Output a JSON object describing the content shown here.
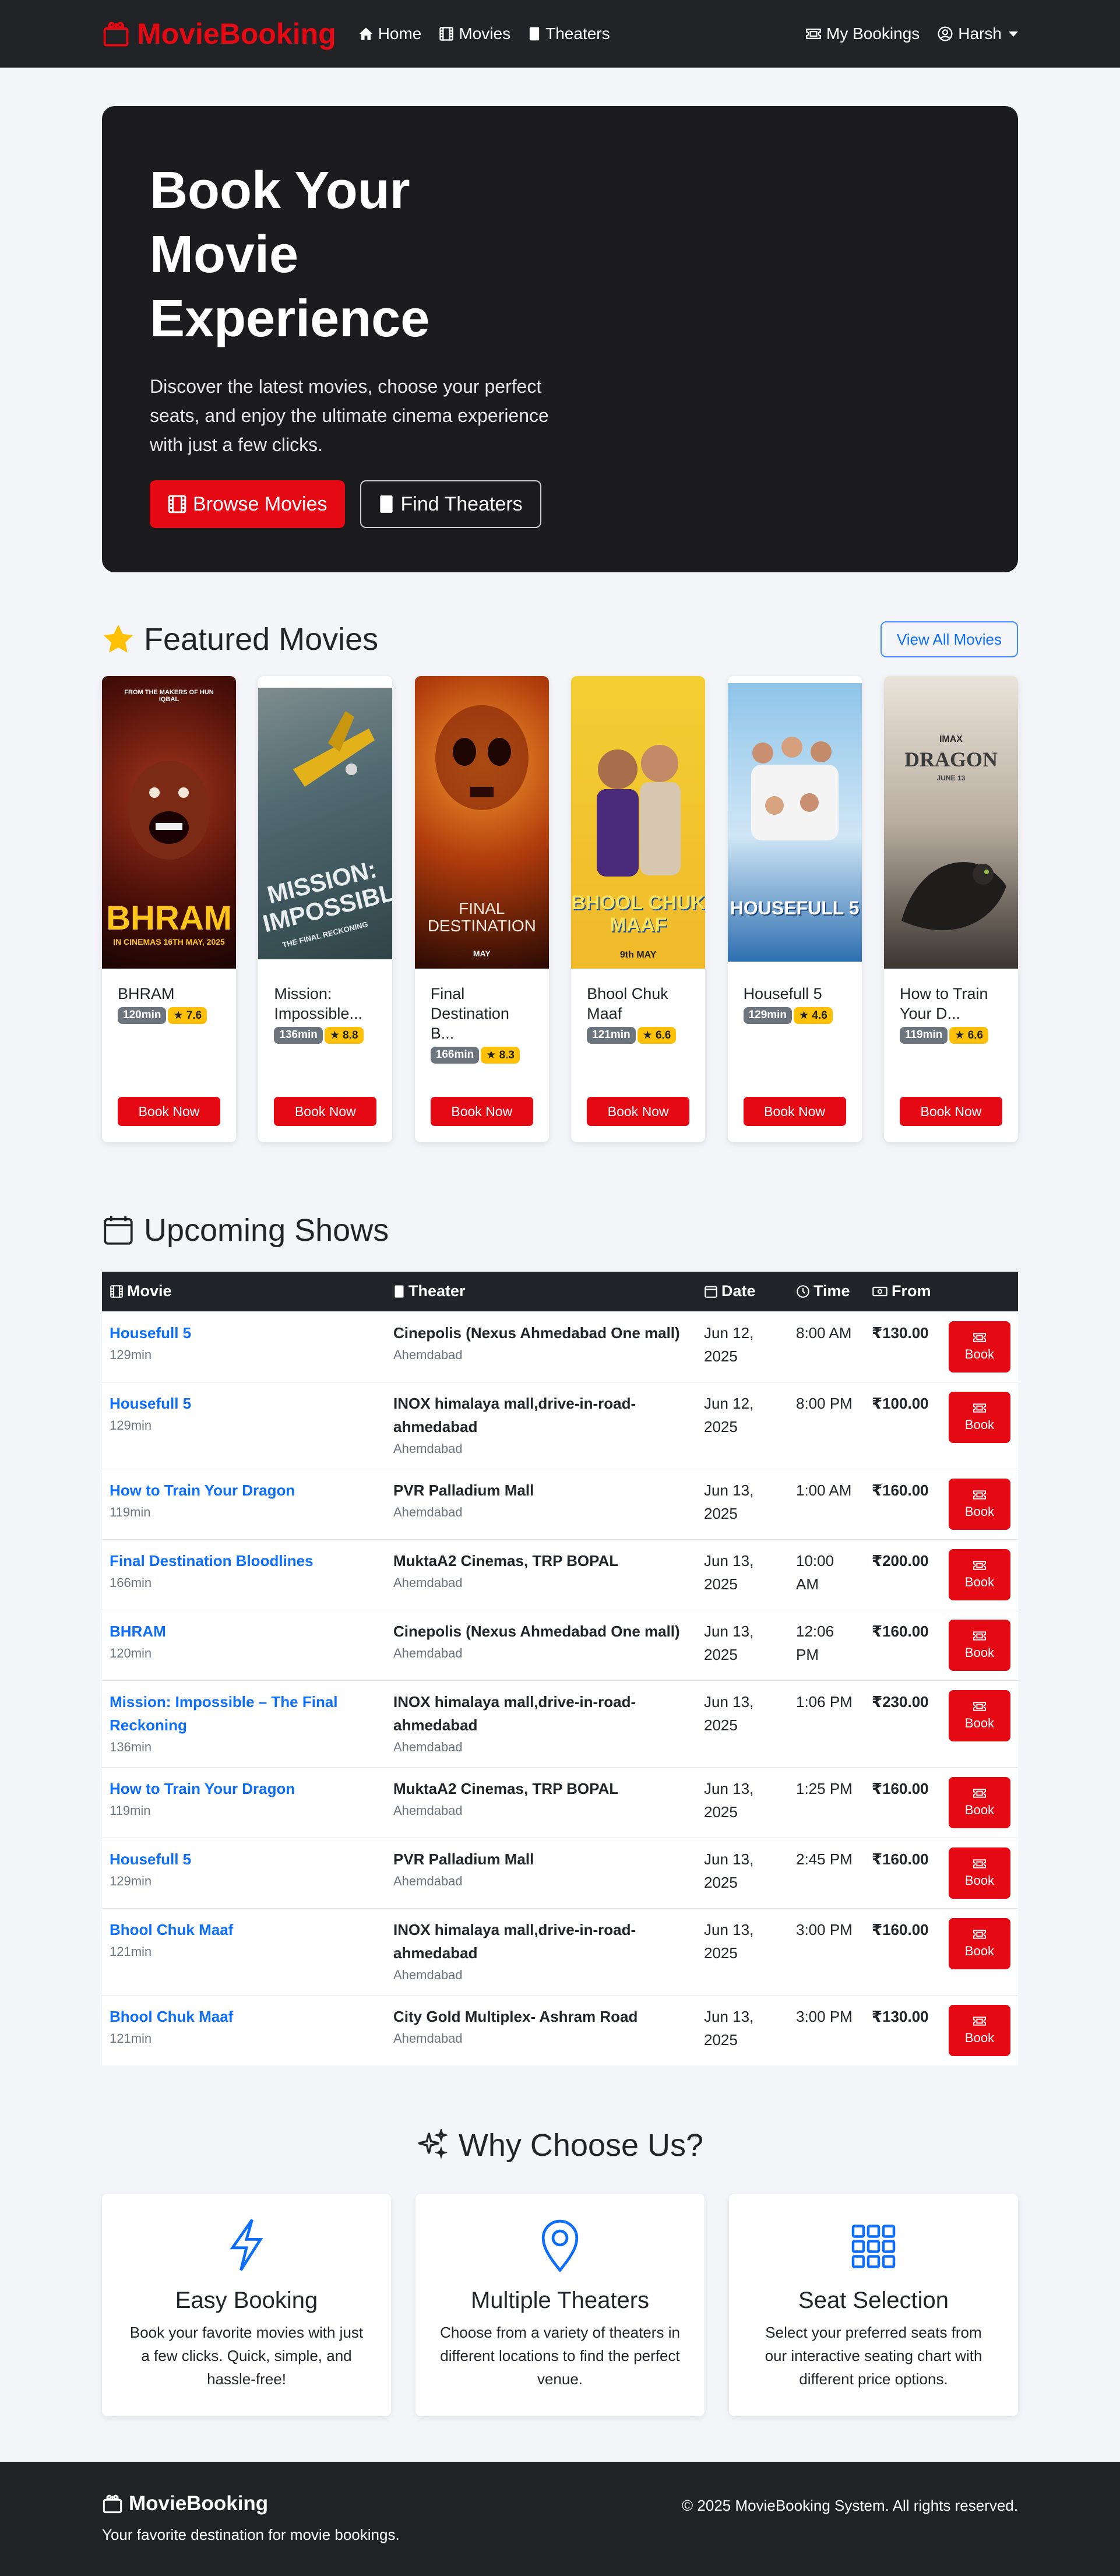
{
  "nav": {
    "brand": "MovieBooking",
    "home": "Home",
    "movies": "Movies",
    "theaters": "Theaters",
    "my_bookings": "My Bookings",
    "user": "Harsh"
  },
  "hero": {
    "title": "Book Your Movie Experience",
    "subtitle": "Discover the latest movies, choose your perfect seats, and enjoy the ultimate cinema experience with just a few clicks.",
    "browse": "Browse Movies",
    "find": "Find Theaters"
  },
  "featured": {
    "title": "Featured Movies",
    "view_all": "View All Movies",
    "book_label": "Book Now",
    "movies": [
      {
        "title": "BHRAM",
        "duration": "120min",
        "rating": "★ 7.6",
        "poster_top": "FROM THE MAKERS OF HUN IQBAL",
        "poster_main": "BHRAM",
        "poster_sub": "IN CINEMAS 16TH MAY, 2025"
      },
      {
        "title": "Mission: Impossible...",
        "duration": "136min",
        "rating": "★ 8.8",
        "poster_main": "MISSION: IMPOSSIBLE",
        "poster_sub": "THE FINAL RECKONING"
      },
      {
        "title": "Final Destination B...",
        "duration": "166min",
        "rating": "★ 8.3",
        "poster_main": "FINAL DESTINATION",
        "poster_sub": "MAY"
      },
      {
        "title": "Bhool Chuk Maaf",
        "duration": "121min",
        "rating": "★ 6.6",
        "poster_main": "BHOOL CHUK MAAF",
        "poster_sub": "9th MAY"
      },
      {
        "title": "Housefull 5",
        "duration": "129min",
        "rating": "★ 4.6",
        "poster_main": "HOUSEFULL 5"
      },
      {
        "title": "How to Train Your D...",
        "duration": "119min",
        "rating": "★ 6.6",
        "poster_top": "IMAX",
        "poster_main": "DRAGON",
        "poster_sub": "JUNE 13"
      }
    ]
  },
  "upcoming": {
    "title": "Upcoming Shows",
    "headers": {
      "movie": "Movie",
      "theater": "Theater",
      "date": "Date",
      "time": "Time",
      "from": "From"
    },
    "book_label": "Book",
    "rows": [
      {
        "movie": "Housefull 5",
        "duration": "129min",
        "theater": "Cinepolis (Nexus Ahmedabad One mall)",
        "city": "Ahemdabad",
        "date": "Jun 12, 2025",
        "time": "8:00 AM",
        "price": "₹130.00"
      },
      {
        "movie": "Housefull 5",
        "duration": "129min",
        "theater": "INOX himalaya mall,drive-in-road-ahmedabad",
        "city": "Ahemdabad",
        "date": "Jun 12, 2025",
        "time": "8:00 PM",
        "price": "₹100.00"
      },
      {
        "movie": "How to Train Your Dragon",
        "duration": "119min",
        "theater": "PVR Palladium Mall",
        "city": "Ahemdabad",
        "date": "Jun 13, 2025",
        "time": "1:00 AM",
        "price": "₹160.00"
      },
      {
        "movie": "Final Destination Bloodlines",
        "duration": "166min",
        "theater": "MuktaA2 Cinemas, TRP BOPAL",
        "city": "Ahemdabad",
        "date": "Jun 13, 2025",
        "time": "10:00 AM",
        "price": "₹200.00"
      },
      {
        "movie": "BHRAM",
        "duration": "120min",
        "theater": "Cinepolis (Nexus Ahmedabad One mall)",
        "city": "Ahemdabad",
        "date": "Jun 13, 2025",
        "time": "12:06 PM",
        "price": "₹160.00"
      },
      {
        "movie": "Mission: Impossible – The Final Reckoning",
        "duration": "136min",
        "theater": "INOX himalaya mall,drive-in-road-ahmedabad",
        "city": "Ahemdabad",
        "date": "Jun 13, 2025",
        "time": "1:06 PM",
        "price": "₹230.00"
      },
      {
        "movie": "How to Train Your Dragon",
        "duration": "119min",
        "theater": "MuktaA2 Cinemas, TRP BOPAL",
        "city": "Ahemdabad",
        "date": "Jun 13, 2025",
        "time": "1:25 PM",
        "price": "₹160.00"
      },
      {
        "movie": "Housefull 5",
        "duration": "129min",
        "theater": "PVR Palladium Mall",
        "city": "Ahemdabad",
        "date": "Jun 13, 2025",
        "time": "2:45 PM",
        "price": "₹160.00"
      },
      {
        "movie": "Bhool Chuk Maaf",
        "duration": "121min",
        "theater": "INOX himalaya mall,drive-in-road-ahmedabad",
        "city": "Ahemdabad",
        "date": "Jun 13, 2025",
        "time": "3:00 PM",
        "price": "₹160.00"
      },
      {
        "movie": "Bhool Chuk Maaf",
        "duration": "121min",
        "theater": "City Gold Multiplex- Ashram Road",
        "city": "Ahemdabad",
        "date": "Jun 13, 2025",
        "time": "3:00 PM",
        "price": "₹130.00"
      }
    ]
  },
  "why": {
    "title": "Why Choose Us?",
    "features": [
      {
        "icon": "lightning-icon",
        "title": "Easy Booking",
        "text": "Book your favorite movies with just a few clicks. Quick, simple, and hassle-free!"
      },
      {
        "icon": "map-pin-icon",
        "title": "Multiple Theaters",
        "text": "Choose from a variety of theaters in different locations to find the perfect venue."
      },
      {
        "icon": "grid-icon",
        "title": "Seat Selection",
        "text": "Select your preferred seats from our interactive seating chart with different price options."
      }
    ]
  },
  "footer": {
    "brand": "MovieBooking",
    "tagline": "Your favorite destination for movie bookings.",
    "copyright": "© 2025 MovieBooking System. All rights reserved."
  },
  "colors": {
    "accent": "#e50914",
    "link": "#0d6efd",
    "dark": "#222326",
    "rating": "#ffc107"
  }
}
